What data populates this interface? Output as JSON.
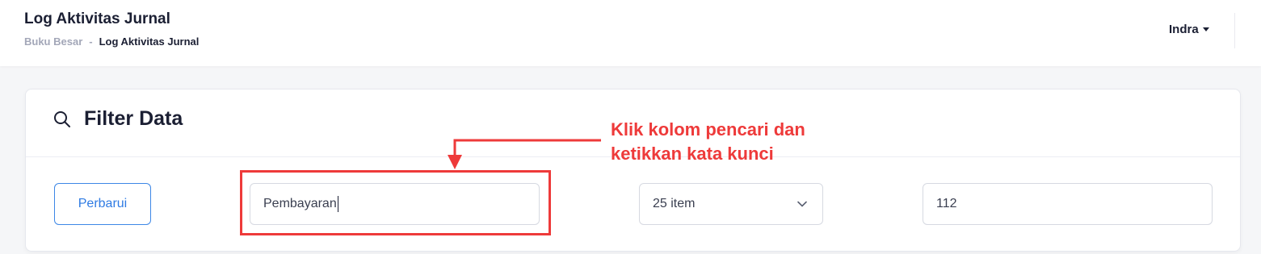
{
  "header": {
    "title": "Log Aktivitas Jurnal",
    "breadcrumb": {
      "parent": "Buku Besar",
      "separator": "-",
      "current": "Log Aktivitas Jurnal"
    },
    "user": "Indra"
  },
  "filter": {
    "title": "Filter Data",
    "icon": "search-icon",
    "refresh_label": "Perbarui",
    "search_value": "Pembayaran",
    "per_page_value": "25 item",
    "page_value": "112"
  },
  "annotation": {
    "line1": "Klik kolom pencari dan",
    "line2": "ketikkan kata kunci",
    "color": "#ee3a3a"
  },
  "colors": {
    "accent": "#2f7be3",
    "annotation": "#ee3a3a",
    "title": "#1b1f33"
  }
}
